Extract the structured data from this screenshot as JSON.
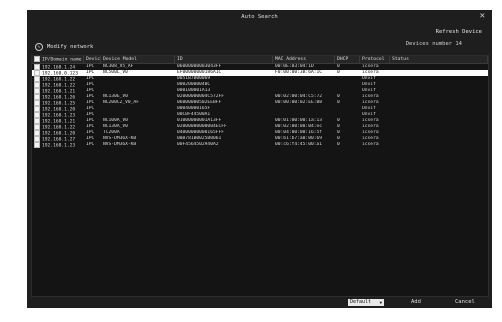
{
  "window": {
    "title": "Auto Search",
    "close_glyph": "✕"
  },
  "toolbar": {
    "refresh_label": "Refresh Device",
    "modify_label": "Modify network",
    "devices_label": "Devices number 14"
  },
  "table": {
    "headers": {
      "ip": "IP/Domain name",
      "type": "Device Ty",
      "model": "Device Model",
      "id": "ID",
      "mac": "MAC Address",
      "dhcp": "DHCP",
      "protocol": "Protocol",
      "status": "Status"
    },
    "rows": [
      {
        "ip": "192.168.1.24",
        "type": "IPC",
        "model": "NC308_V5_AF",
        "id": "06000000003043FF",
        "mac": "00:0E:03:04:1D",
        "dhcp": "0",
        "protocol": "icsera",
        "status": ""
      },
      {
        "ip": "192.168.0.123",
        "type": "IPC",
        "model": "NC500L_V0",
        "id": "EF00000000186A1C",
        "mac": "F0:00:00:3B:6A:1C",
        "dhcp": "0",
        "protocol": "icsera",
        "status": ""
      },
      {
        "ip": "192.168.1.22",
        "type": "IPC",
        "model": "",
        "id": "0051B7B00069",
        "mac": "",
        "dhcp": "",
        "protocol": "Onvif",
        "status": ""
      },
      {
        "ip": "192.168.1.22",
        "type": "IPC",
        "model": "",
        "id": "0002000004BC",
        "mac": "",
        "dhcp": "",
        "protocol": "Onvif",
        "status": ""
      },
      {
        "ip": "192.168.1.21",
        "type": "IPC",
        "model": "",
        "id": "000100001A13",
        "mac": "",
        "dhcp": "",
        "protocol": "Onvif",
        "status": ""
      },
      {
        "ip": "192.168.1.26",
        "type": "IPC",
        "model": "NC130E_V0",
        "id": "02000000004C572FF",
        "mac": "00:02:00:04:C5:72",
        "dhcp": "0",
        "protocol": "icsera",
        "status": ""
      },
      {
        "ip": "192.168.1.25",
        "type": "IPC",
        "model": "NC200C2_V0_AF",
        "id": "06000000502EEBFF",
        "mac": "00:00:00:02:EE:B8",
        "dhcp": "0",
        "protocol": "icsera",
        "status": ""
      },
      {
        "ip": "192.168.1.20",
        "type": "IPC",
        "model": "",
        "id": "00040000165F",
        "mac": "",
        "dhcp": "",
        "protocol": "Onvif",
        "status": ""
      },
      {
        "ip": "192.168.1.23",
        "type": "IPC",
        "model": "",
        "id": "00CBF44500A1",
        "mac": "",
        "dhcp": "",
        "protocol": "Onvif",
        "status": ""
      },
      {
        "ip": "192.168.1.21",
        "type": "IPC",
        "model": "NC100A_V0",
        "id": "01000000001A13FF",
        "mac": "00:01:00:00:1a:13",
        "dhcp": "0",
        "protocol": "icsera",
        "status": ""
      },
      {
        "ip": "192.168.1.22",
        "type": "IPC",
        "model": "NC130A_V0",
        "id": "02000000000004ECFF",
        "mac": "00:02:00:00:04:ec",
        "dhcp": "0",
        "protocol": "icsera",
        "status": ""
      },
      {
        "ip": "192.168.1.20",
        "type": "IPC",
        "model": "TC200A",
        "id": "04000000000165FFF",
        "mac": "00:04:00:00:16:5f",
        "dhcp": "0",
        "protocol": "icsera",
        "status": ""
      },
      {
        "ip": "192.168.1.27",
        "type": "IPC",
        "model": "NVS-DM36X-KB",
        "id": "00B781B0025B0061",
        "mac": "00:b1:b7:a0:00:69",
        "dhcp": "0",
        "protocol": "icsera",
        "status": ""
      },
      {
        "ip": "192.168.1.23",
        "type": "IPC",
        "model": "NVS-DM36X-KB",
        "id": "00F4564502940A2",
        "mac": "00:c6:f4:45:00:a1",
        "dhcp": "0",
        "protocol": "icsera",
        "status": ""
      }
    ],
    "selected_index": 1
  },
  "footer": {
    "select_value": "Default",
    "add_label": "Add",
    "cancel_label": "Cancel"
  },
  "colors": {
    "background": "#1e1e1e",
    "selected_row": "#ffffff",
    "text": "#d8d8d8"
  },
  "icons": {
    "close": "close-icon",
    "modify": "network-edit-icon",
    "dropdown": "chevron-down-icon"
  }
}
